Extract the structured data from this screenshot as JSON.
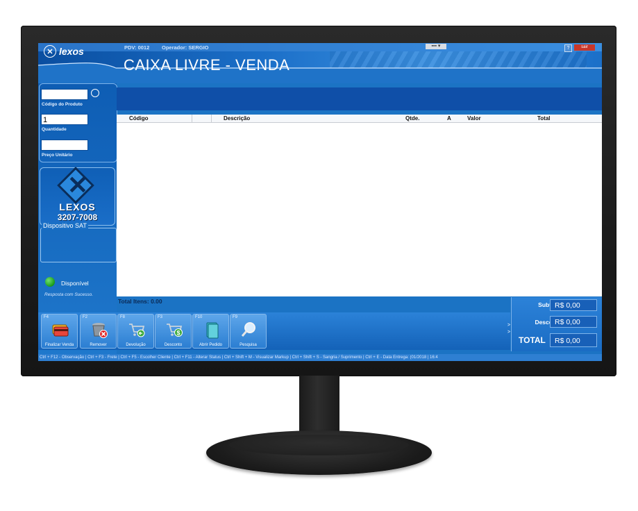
{
  "app": {
    "brand": "lexos",
    "pdv": "PDV: 0012",
    "operator": "Operador: SERGIO",
    "title": "CAIXA LIVRE - VENDA",
    "help": "?",
    "close": "sair"
  },
  "left_panel": {
    "product_code_label": "Código do Produto",
    "product_code_value": "",
    "quantity_label": "Quantidade",
    "quantity_value": "1",
    "unit_price_label": "Preço Unitário",
    "unit_price_value": "",
    "logo_name": "LEXOS",
    "logo_phone": "3207-7008",
    "sat_legend": "Dispositivo SAT",
    "sat_status": "Disponível",
    "sat_message": "Resposta com Sucesso."
  },
  "grid": {
    "columns": [
      "Código",
      "Descrição",
      "Qtde.",
      "A",
      "Valor",
      "Total"
    ],
    "rows": []
  },
  "total_items": "Total Itens: 0.00",
  "toolbar": [
    {
      "key": "F4",
      "label": "Finalizar Venda",
      "icon": "credit-card-icon"
    },
    {
      "key": "F2",
      "label": "Remover",
      "icon": "trash-remove-icon"
    },
    {
      "key": "F8",
      "label": "Devolução",
      "icon": "cart-return-icon"
    },
    {
      "key": "F3",
      "label": "Desconto",
      "icon": "cart-discount-icon"
    },
    {
      "key": "F10",
      "label": "Abrir Pedido",
      "icon": "folder-icon"
    },
    {
      "key": "F9",
      "label": "Pesquisa",
      "icon": "magnifier-icon"
    }
  ],
  "totals": {
    "subtotal_label": "Subtotal:",
    "subtotal_value": "R$ 0,00",
    "discount_label": "Desconto:",
    "discount_value": "R$ 0,00",
    "total_label": "TOTAL",
    "total_value": "R$ 0,00"
  },
  "statusbar": "Ctrl + F12 - Observação | Ctrl + F3 - Frete | Ctrl + F5 - Escolher Cliente | Ctrl + F11 - Alterar Status | Ctrl + Shift + M - Visualizar Markup | Ctrl + Shift + S - Sangria / Suprimento | Ctrl + E - Data Entrega: (01/2018 | 16:4"
}
